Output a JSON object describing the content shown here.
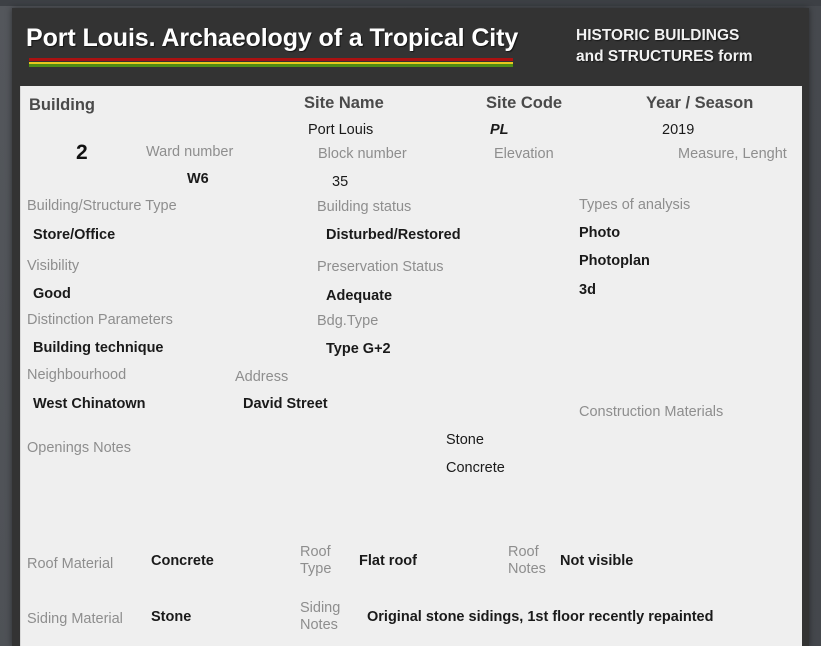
{
  "header": {
    "title": "Port Louis. Archaeology of a Tropical City",
    "form_kicker_line1": "HISTORIC BUILDINGS",
    "form_kicker_line2": "and STRUCTURES  form",
    "rule_colors": [
      "#aa1111",
      "#e8c81e",
      "#4e8c16"
    ]
  },
  "columns": {
    "building_header": "Building",
    "site_name_header": "Site Name",
    "site_code_header": "Site Code",
    "year_season_header": "Year / Season"
  },
  "fields": {
    "building_number": "2",
    "site_name": "Port Louis",
    "site_code": "PL",
    "year_season": "2019",
    "ward_number_label": "Ward number",
    "ward_number": "W6",
    "block_number_label": "Block number",
    "block_number": "35",
    "elevation_label": "Elevation",
    "elevation": "",
    "measure_length_label": "Measure, Lenght",
    "measure_length": "",
    "building_structure_type_label": "Building/Structure Type",
    "building_structure_type": "Store/Office",
    "building_status_label": "Building status",
    "building_status": "Disturbed/Restored",
    "types_of_analysis_label": "Types of analysis",
    "types_of_analysis": [
      "Photo",
      "Photoplan",
      "3d"
    ],
    "visibility_label": "Visibility",
    "visibility": "Good",
    "preservation_status_label": "Preservation Status",
    "preservation_status": "Adequate",
    "distinction_parameters_label": "Distinction Parameters",
    "distinction_parameters": "Building technique",
    "bdg_type_label": "Bdg.Type",
    "bdg_type": "Type G+2",
    "neighbourhood_label": "Neighbourhood",
    "neighbourhood": "West Chinatown",
    "address_label": "Address",
    "address": "David Street",
    "construction_materials_label": "Construction Materials",
    "construction_materials": [
      "Stone",
      "Concrete"
    ],
    "openings_notes_label": "Openings Notes",
    "openings_notes": "",
    "roof_material_label": "Roof Material",
    "roof_material": "Concrete",
    "roof_type_label": "Roof\nType",
    "roof_type_label_l1": "Roof",
    "roof_type_label_l2": "Type",
    "roof_type": "Flat roof",
    "roof_notes_label_l1": "Roof",
    "roof_notes_label_l2": "Notes",
    "roof_notes": "Not visible",
    "siding_material_label": "Siding Material",
    "siding_material": "Stone",
    "siding_notes_label_l1": "Siding",
    "siding_notes_label_l2": "Notes",
    "siding_notes": "Original stone sidings, 1st floor recently repainted"
  }
}
